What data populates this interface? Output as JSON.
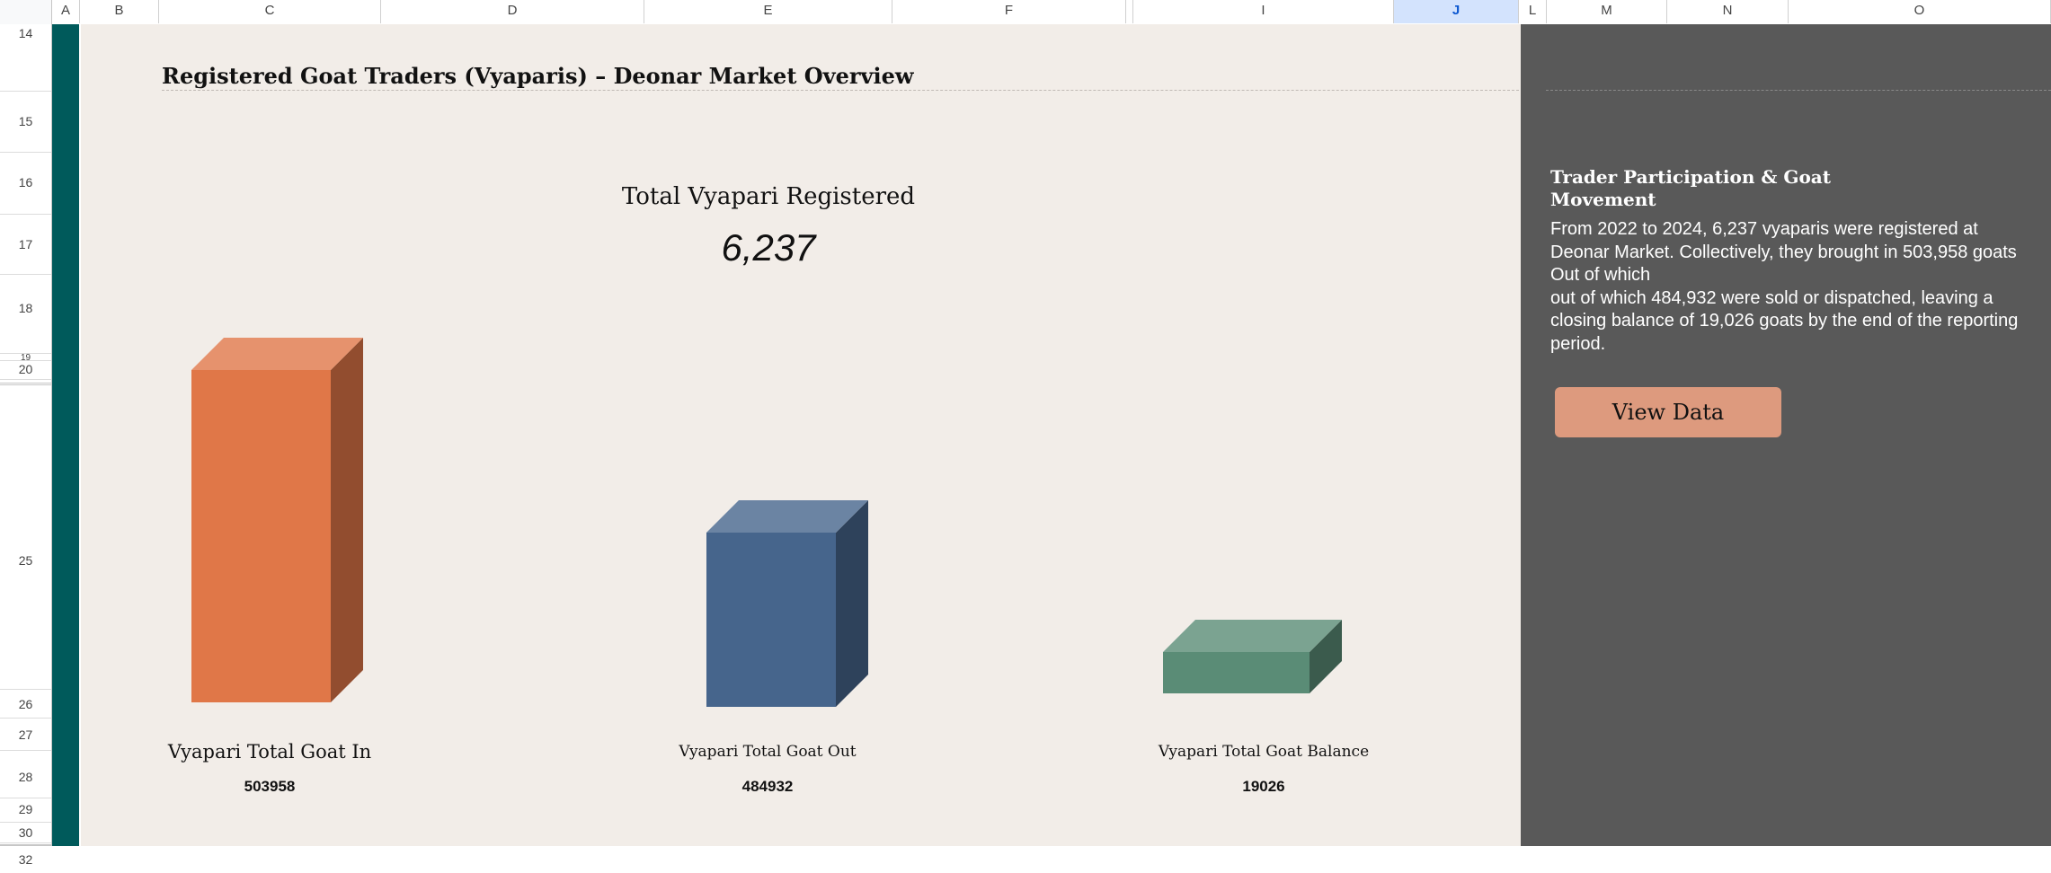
{
  "sheet": {
    "columns": [
      {
        "label": "A",
        "selected": false
      },
      {
        "label": "B",
        "selected": false
      },
      {
        "label": "C",
        "selected": false
      },
      {
        "label": "D",
        "selected": false
      },
      {
        "label": "E",
        "selected": false
      },
      {
        "label": "F",
        "selected": false
      },
      {
        "label": "I",
        "selected": false
      },
      {
        "label": "J",
        "selected": true
      },
      {
        "label": "L",
        "selected": false
      },
      {
        "label": "M",
        "selected": false
      },
      {
        "label": "N",
        "selected": false
      },
      {
        "label": "O",
        "selected": false
      }
    ],
    "rows": [
      "14",
      "15",
      "16",
      "17",
      "18",
      "19",
      "20",
      "25",
      "26",
      "27",
      "28",
      "29",
      "30",
      "32"
    ],
    "colors": {
      "accent_strip": "#005a5b",
      "panel_bg": "#f2ede8",
      "side_bg": "#595959",
      "selected_header": "#d3e3fd"
    }
  },
  "dashboard": {
    "title": "Registered Goat Traders (Vyaparis) – Deonar Market Overview",
    "kpi": {
      "label": "Total Vyapari Registered",
      "value": "6,237"
    }
  },
  "chart_data": {
    "type": "bar",
    "categories": [
      "Vyapari Total Goat In",
      "Vyapari Total Goat Out",
      "Vyapari Total Goat Balance"
    ],
    "values": [
      503958,
      484932,
      19026
    ],
    "value_labels": [
      "503958",
      "484932",
      "19026"
    ],
    "colors": [
      "#e07748",
      "#46658c",
      "#5a8c76"
    ],
    "style": "3d-cuboid",
    "grid": false,
    "legend": "none"
  },
  "side_panel": {
    "title_lines": [
      "Trader Participation & Goat",
      "Movement"
    ],
    "body_lines": [
      "From 2022 to 2024, 6,237 vyaparis were registered at",
      "Deonar Market. Collectively, they brought in 503,958 goats",
      "Out of which",
      "out of which 484,932 were sold or dispatched, leaving a",
      "closing balance of 19,026 goats by the end of the reporting",
      "period."
    ],
    "button_label": "View Data",
    "button_color": "#dd9a7e"
  }
}
